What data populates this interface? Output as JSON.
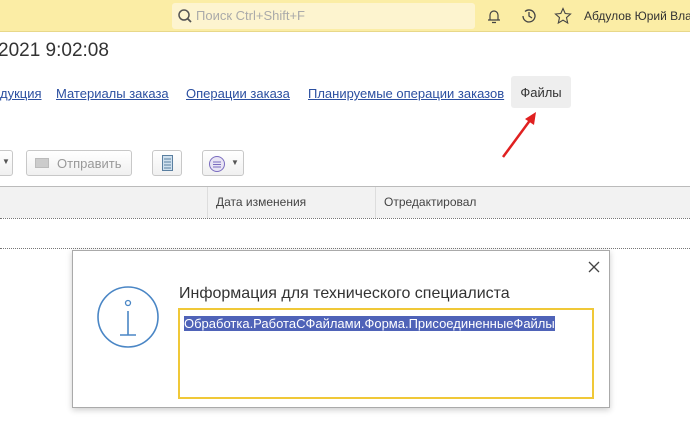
{
  "topbar": {
    "search_placeholder": "Поиск Ctrl+Shift+F",
    "user_name": "Абдулов Юрий Влад",
    "icons": [
      "bell-icon",
      "history-icon",
      "star-icon"
    ]
  },
  "header": {
    "title": "2021 9:02:08"
  },
  "tabs": [
    {
      "label": "дукция"
    },
    {
      "label": "Материалы заказа"
    },
    {
      "label": "Операции заказа"
    },
    {
      "label": "Планируемые операции заказов"
    },
    {
      "label": "Файлы",
      "active": true
    }
  ],
  "toolbar": {
    "send_label": "Отправить"
  },
  "table": {
    "columns": [
      "Дата изменения",
      "Отредактировал"
    ]
  },
  "dialog": {
    "title": "Информация для технического специалиста",
    "text": "Обработка.РаботаСФайлами.Форма.ПрисоединенныеФайлы"
  },
  "colors": {
    "topbar": "#fbeda5",
    "link": "#2b4fa0",
    "annotation_arrow": "#e02020",
    "field_border": "#f0c838",
    "selection": "#4f63b8"
  }
}
